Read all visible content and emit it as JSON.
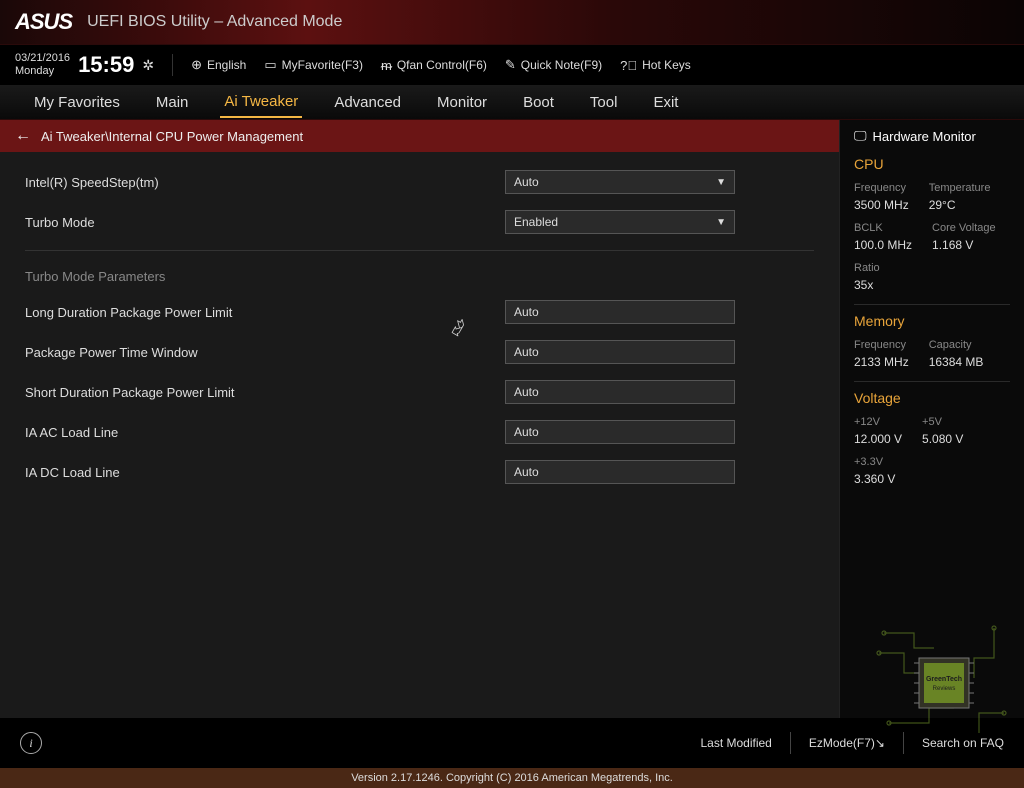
{
  "header": {
    "brand": "ASUS",
    "title": "UEFI BIOS Utility – Advanced Mode"
  },
  "topbar": {
    "date": "03/21/2016",
    "day": "Monday",
    "clock": "15:59",
    "language": "English",
    "links": {
      "fav": "MyFavorite(F3)",
      "qfan": "Qfan Control(F6)",
      "note": "Quick Note(F9)",
      "hotkeys": "Hot Keys"
    }
  },
  "tabs": [
    "My Favorites",
    "Main",
    "Ai Tweaker",
    "Advanced",
    "Monitor",
    "Boot",
    "Tool",
    "Exit"
  ],
  "active_tab": "Ai Tweaker",
  "breadcrumb": "Ai Tweaker\\Internal CPU Power Management",
  "settings": {
    "speedstep": {
      "label": "Intel(R) SpeedStep(tm)",
      "value": "Auto"
    },
    "turbo": {
      "label": "Turbo Mode",
      "value": "Enabled"
    },
    "section": "Turbo Mode Parameters",
    "long_power": {
      "label": "Long Duration Package Power Limit",
      "value": "Auto"
    },
    "time_window": {
      "label": "Package Power Time Window",
      "value": "Auto"
    },
    "short_power": {
      "label": "Short Duration Package Power Limit",
      "value": "Auto"
    },
    "ia_ac": {
      "label": "IA AC Load Line",
      "value": "Auto"
    },
    "ia_dc": {
      "label": "IA DC Load Line",
      "value": "Auto"
    }
  },
  "hw": {
    "title": "Hardware Monitor",
    "cpu": {
      "title": "CPU",
      "freq_label": "Frequency",
      "freq": "3500 MHz",
      "temp_label": "Temperature",
      "temp": "29°C",
      "bclk_label": "BCLK",
      "bclk": "100.0 MHz",
      "vcore_label": "Core Voltage",
      "vcore": "1.168 V",
      "ratio_label": "Ratio",
      "ratio": "35x"
    },
    "mem": {
      "title": "Memory",
      "freq_label": "Frequency",
      "freq": "2133 MHz",
      "cap_label": "Capacity",
      "cap": "16384 MB"
    },
    "volt": {
      "title": "Voltage",
      "v12_label": "+12V",
      "v12": "12.000 V",
      "v5_label": "+5V",
      "v5": "5.080 V",
      "v33_label": "+3.3V",
      "v33": "3.360 V"
    }
  },
  "footer": {
    "last_modified": "Last Modified",
    "ezmode": "EzMode(F7)",
    "search": "Search on FAQ",
    "version": "Version 2.17.1246. Copyright (C) 2016 American Megatrends, Inc."
  },
  "watermark": "GreenTech Reviews"
}
